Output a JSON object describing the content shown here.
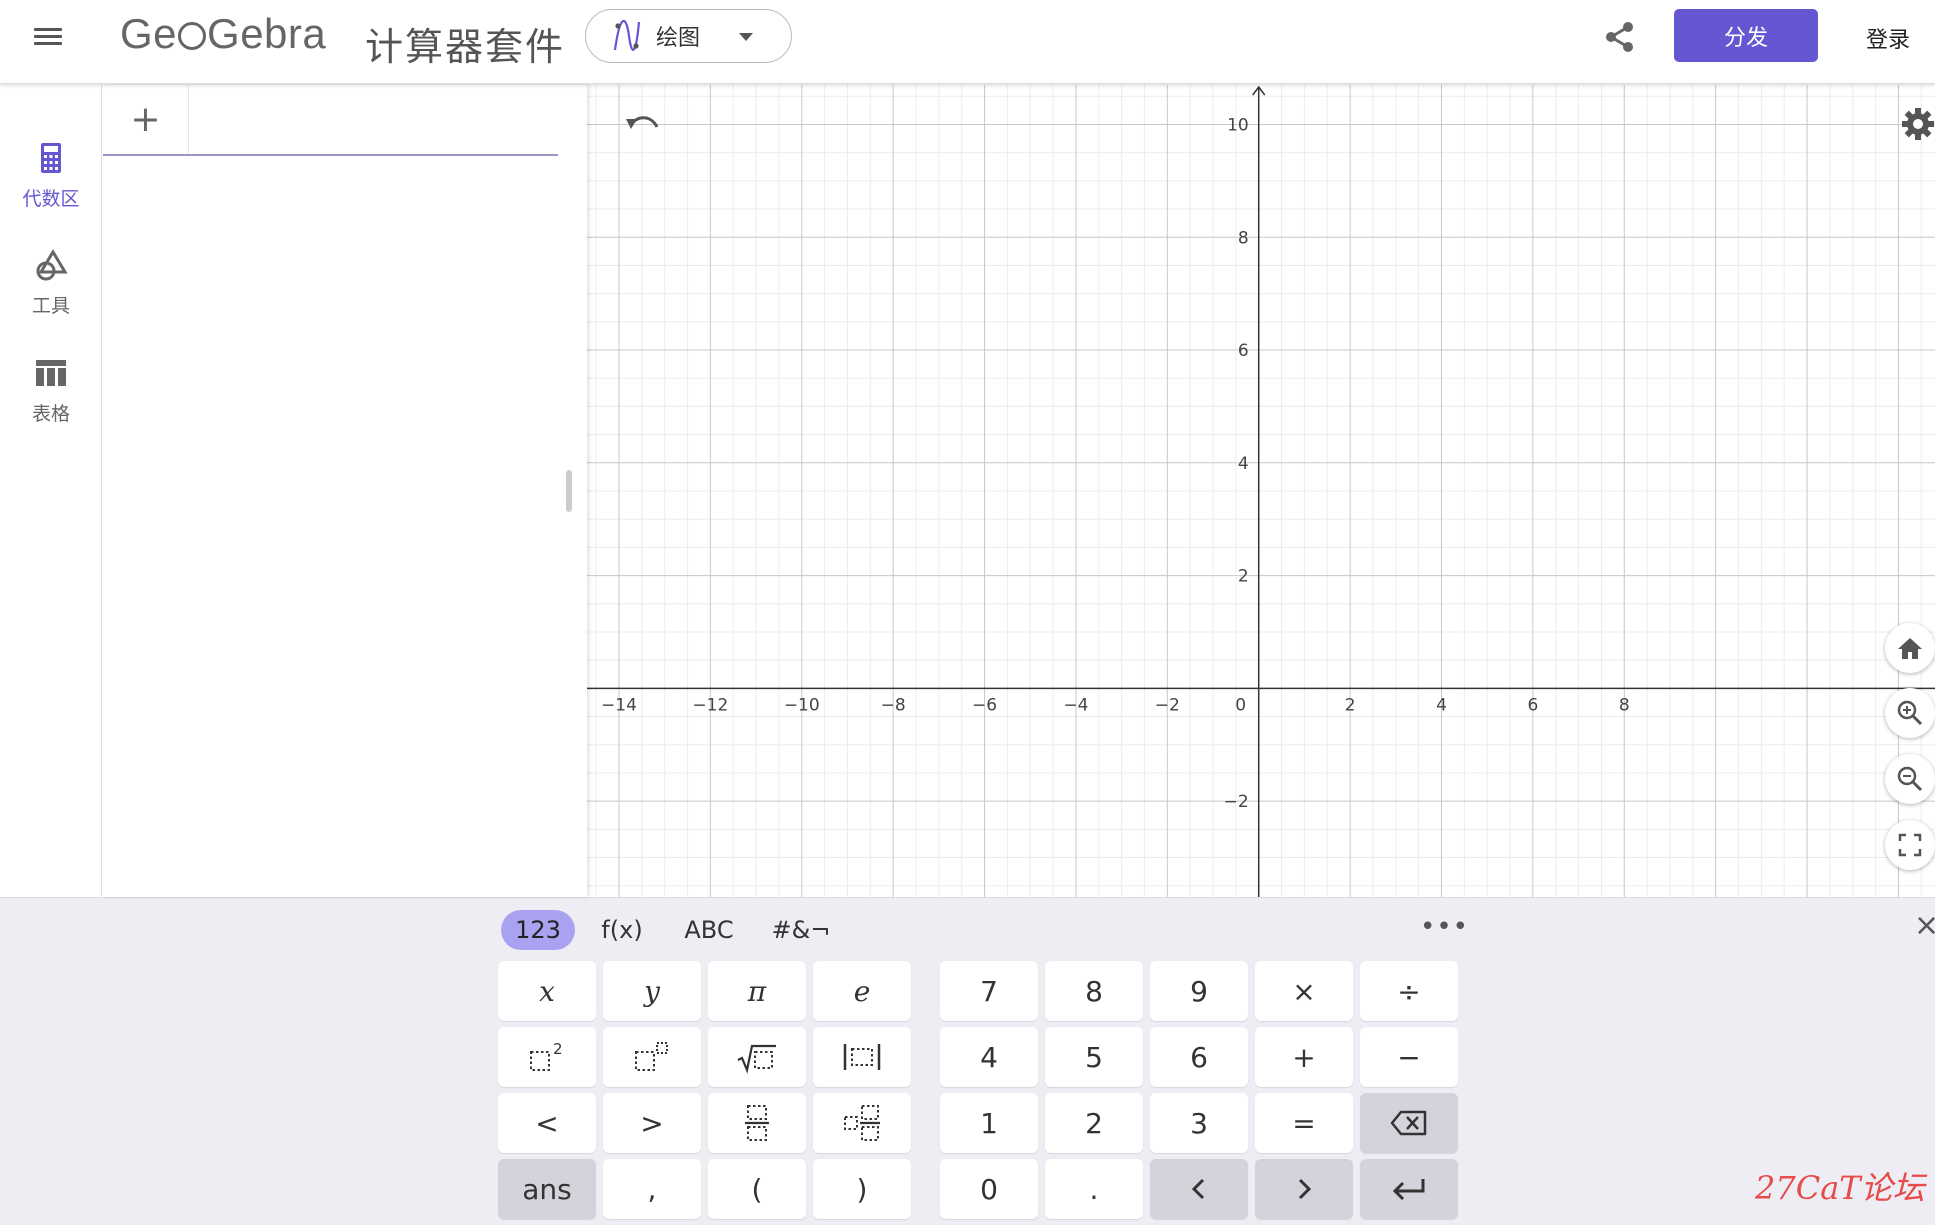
{
  "header": {
    "logo_left": "Ge",
    "logo_right": "Gebra",
    "suite_title": "计算器套件",
    "app_picker_label": "绘图",
    "share_button": "分发",
    "login": "登录"
  },
  "sidebar": {
    "items": [
      {
        "label": "代数区",
        "icon": "calculator-icon",
        "active": true
      },
      {
        "label": "工具",
        "icon": "shapes-icon",
        "active": false
      },
      {
        "label": "表格",
        "icon": "table-icon",
        "active": false
      }
    ]
  },
  "algebra": {
    "add_symbol": "+"
  },
  "graphics": {
    "x_ticks": [
      "−14",
      "−12",
      "−10",
      "−8",
      "−6",
      "−4",
      "−2",
      "0",
      "2",
      "4",
      "6",
      "8"
    ],
    "y_ticks": [
      "10",
      "8",
      "6",
      "4",
      "2",
      "−2"
    ],
    "x_range": [
      -14.7,
      14.8
    ],
    "y_range": [
      -3.7,
      10.7
    ],
    "grid": true
  },
  "keyboard": {
    "tabs": [
      "123",
      "f(x)",
      "ABC",
      "#&¬"
    ],
    "active_tab": "123",
    "more": "•••",
    "close": "×",
    "keys_left_row1": [
      "x",
      "y",
      "π",
      "e"
    ],
    "keys_left_row3": [
      "<",
      ">"
    ],
    "keys_left_row4": [
      "ans",
      ",",
      "(",
      ")"
    ],
    "keys_right_row1": [
      "7",
      "8",
      "9",
      "×",
      "÷"
    ],
    "keys_right_row2": [
      "4",
      "5",
      "6",
      "+",
      "−"
    ],
    "keys_right_row3": [
      "1",
      "2",
      "3",
      "="
    ],
    "keys_right_row4": [
      "0",
      "."
    ],
    "sup_two": "2"
  },
  "watermark": "27CaT论坛"
}
